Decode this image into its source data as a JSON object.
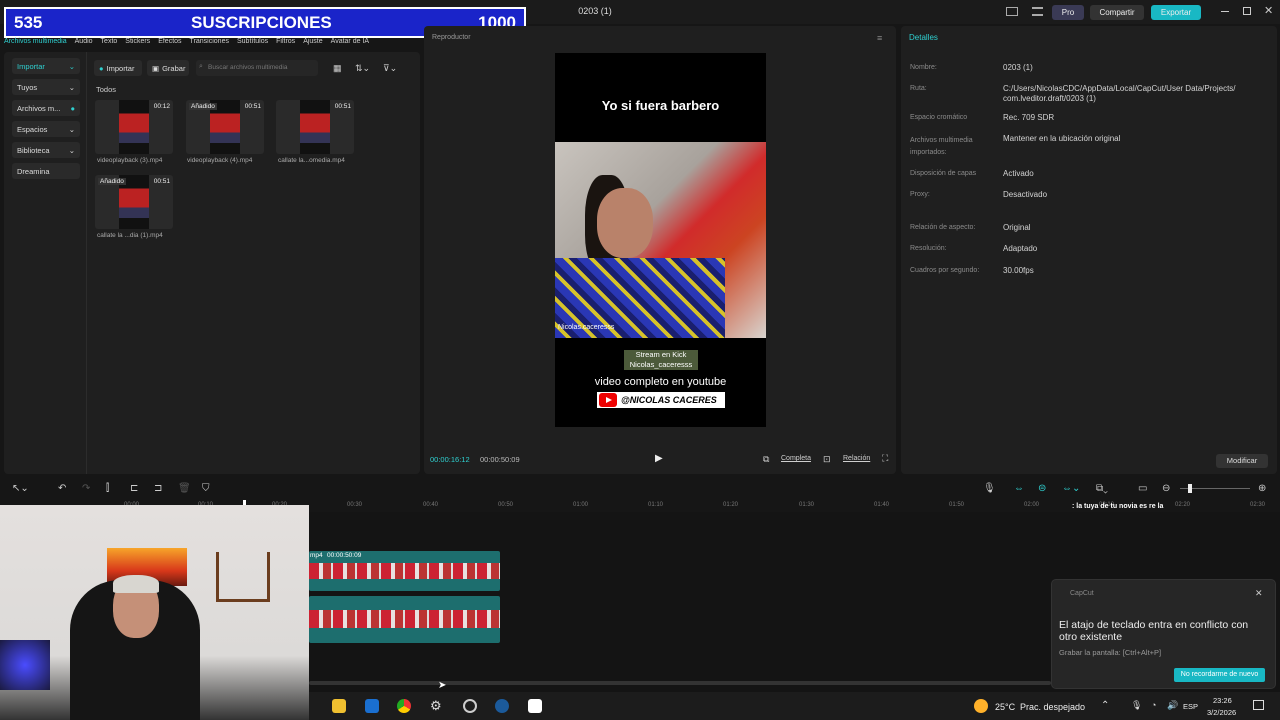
{
  "window": {
    "title": "0203 (1)",
    "pro": "Pro",
    "share": "Compartir",
    "export": "Exportar"
  },
  "overlay": {
    "count_left": "535",
    "label": "SUSCRIPCIONES",
    "count_right": "1000"
  },
  "top_tabs": [
    "Archivos multimedia",
    "Audio",
    "Texto",
    "Stickers",
    "Efectos",
    "Transiciones",
    "Subtítulos",
    "Filtros",
    "Ajuste",
    "Avatar de IA"
  ],
  "left_nav": [
    "Importar",
    "Tuyos",
    "Archivos m...",
    "Espacios",
    "Biblioteca",
    "Dreamina"
  ],
  "media": {
    "import": "Importar",
    "record": "Grabar",
    "search_placeholder": "Buscar archivos multimedia",
    "section": "Todos",
    "items": [
      {
        "name": "videoplayback (3).mp4",
        "dur": "00:12",
        "added": ""
      },
      {
        "name": "videoplayback (4).mp4",
        "dur": "00:51",
        "added": "Añadido"
      },
      {
        "name": "callate la...omedia.mp4",
        "dur": "00:51",
        "added": ""
      },
      {
        "name": "callate la ...dia (1).mp4",
        "dur": "00:51",
        "added": "Añadido"
      }
    ]
  },
  "player": {
    "label": "Reproductor",
    "headline": "Yo si fuera barbero",
    "watermark": "Nicolas.caceresss",
    "kick_line1": "Stream en Kick",
    "kick_line2": "Nicolas_caceresss",
    "full_video": "video completo en youtube",
    "yt_handle": "@NICOLAS CACERES",
    "time_current": "00:00:16:12",
    "time_total": "00:00:50:09",
    "full": "Completa",
    "ratio": "Relación"
  },
  "details": {
    "title": "Detalles",
    "rows": [
      {
        "label": "Nombre:",
        "value": "0203 (1)"
      },
      {
        "label": "Ruta:",
        "value": "C:/Users/NicolasCDC/AppData/Local/CapCut/User Data/Projects/ com.lveditor.draft/0203 (1)"
      },
      {
        "label": "Espacio cromático",
        "value": "Rec. 709 SDR"
      },
      {
        "label": "Archivos multimedia importados:",
        "value": "Mantener en la ubicación original"
      },
      {
        "label": "Disposición de capas",
        "value": "Activado"
      },
      {
        "label": "Proxy:",
        "value": "Desactivado"
      },
      {
        "label": "Relación de aspecto:",
        "value": "Original"
      },
      {
        "label": "Resolución:",
        "value": "Adaptado"
      },
      {
        "label": "Cuadros por segundo:",
        "value": "30.00fps"
      }
    ],
    "modify": "Modificar"
  },
  "timeline": {
    "ticks": [
      "00:00",
      "00:10",
      "00:20",
      "00:30",
      "00:40",
      "00:50",
      "01:00",
      "01:10",
      "01:20",
      "01:30",
      "01:40",
      "01:50",
      "02:00",
      "02:10",
      "02:20",
      "02:30"
    ],
    "clip_label": "mp4",
    "clip_duration": "00:00:50:09",
    "chat": ": la tuya de tu novia es re la"
  },
  "notification": {
    "app": "CapCut",
    "message": "El atajo de teclado entra en conflicto con otro existente",
    "hint": "Grabar la pantalla: [Ctrl+Alt+P]",
    "button": "No recordarme de nuevo"
  },
  "taskbar": {
    "weather": "25°C",
    "weather_desc": "Prac. despejado",
    "lang": "ESP",
    "time": "23:26",
    "date": "3/2/2026"
  }
}
